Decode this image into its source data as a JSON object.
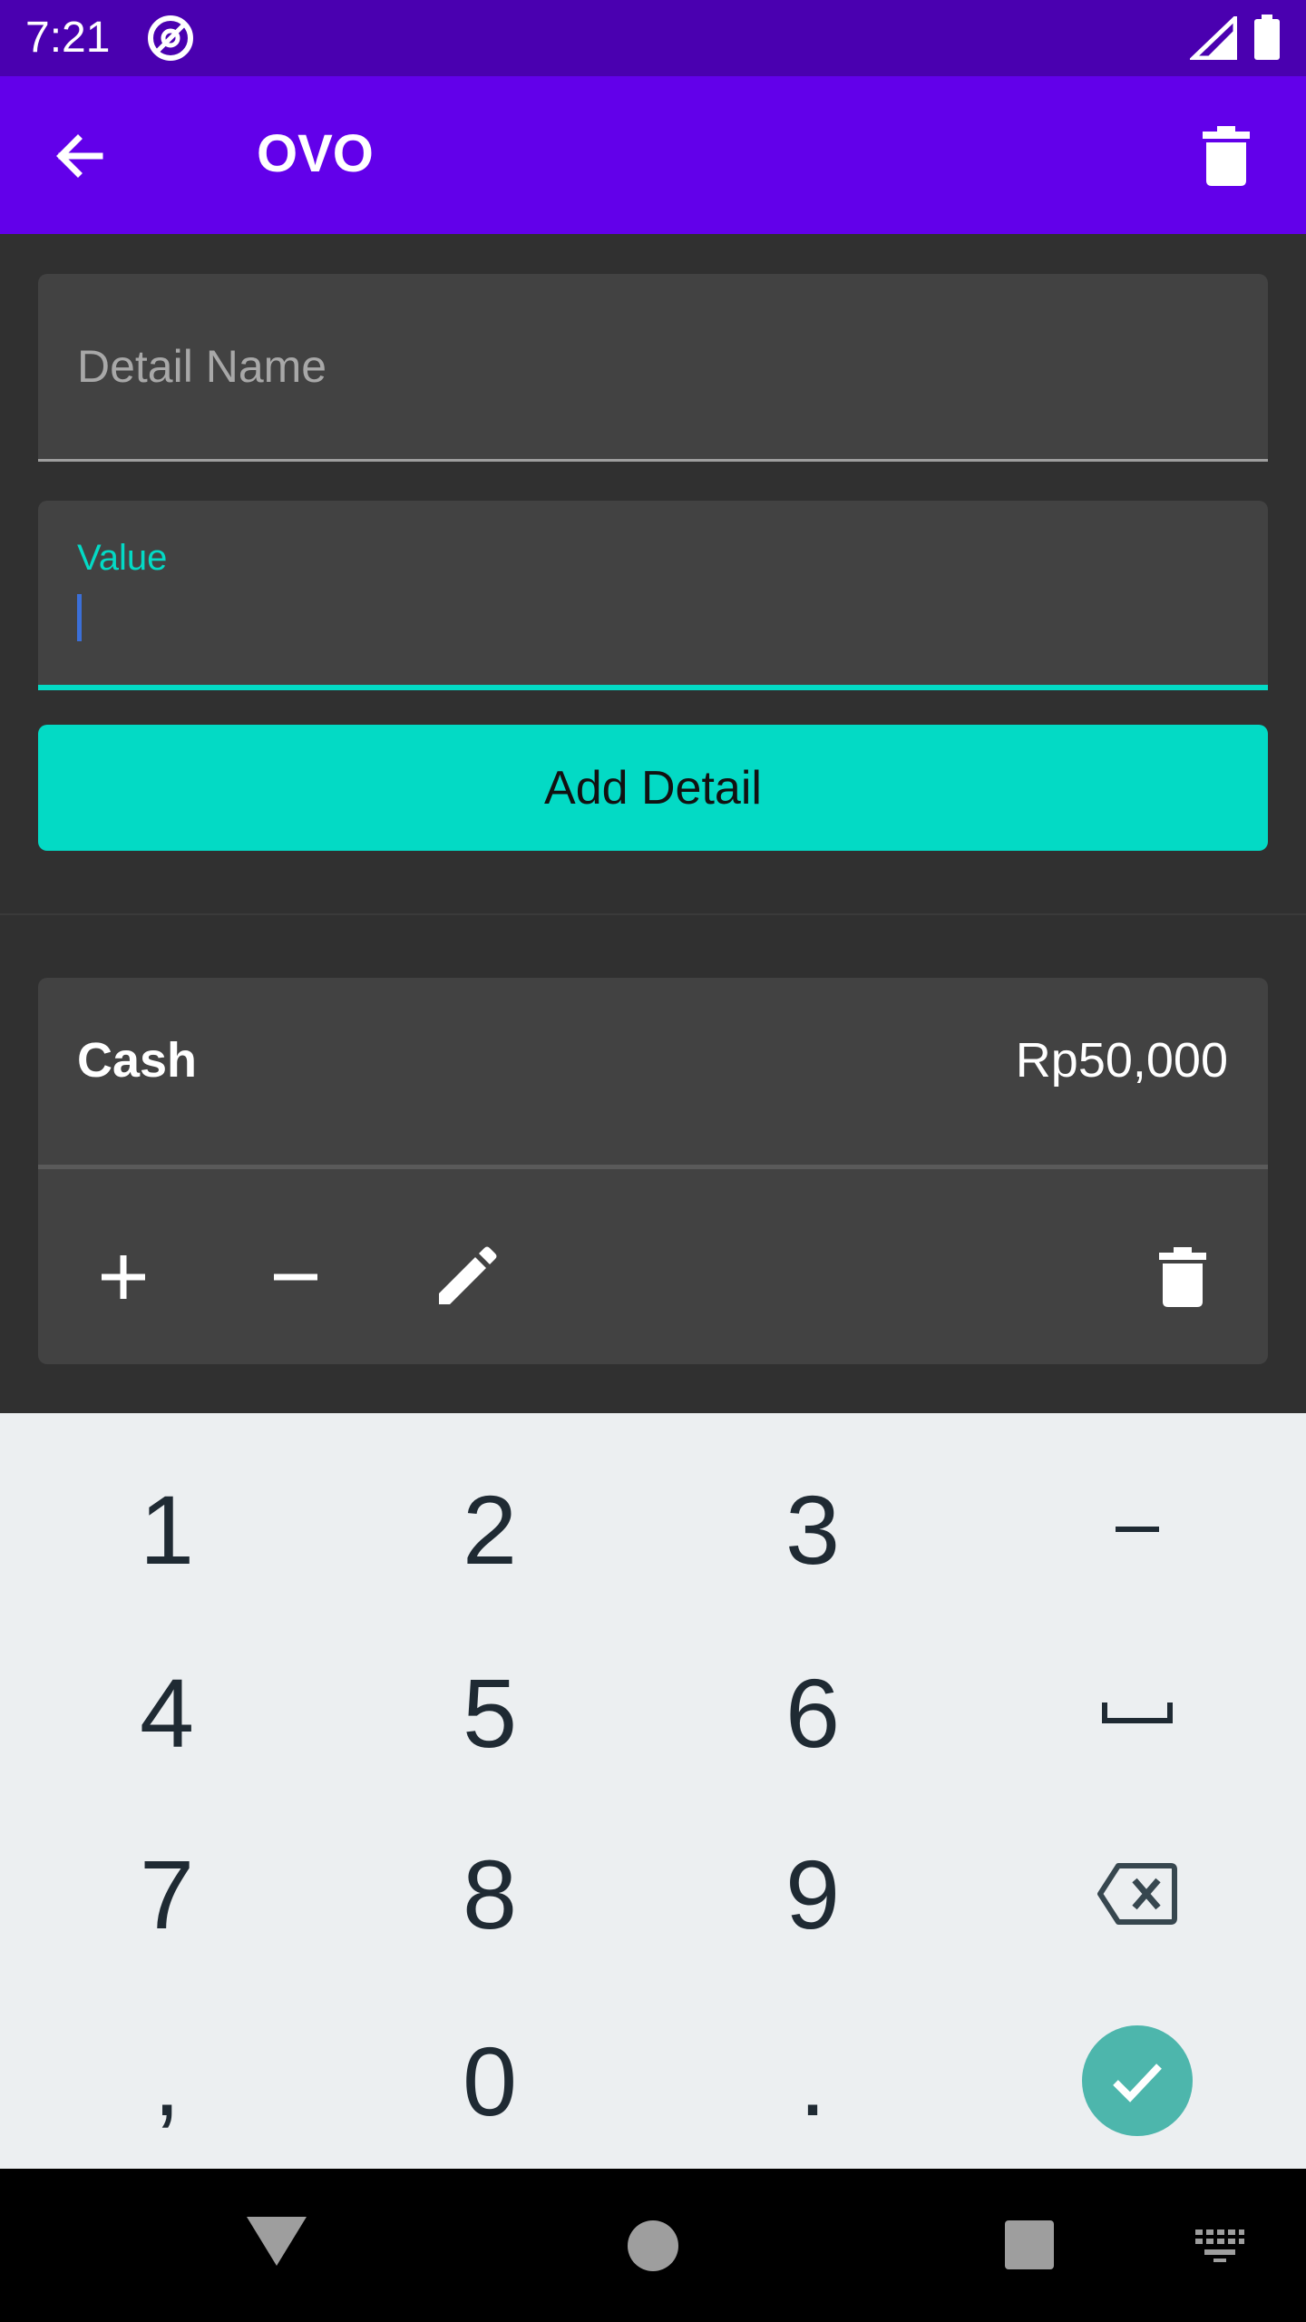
{
  "status_bar": {
    "time": "7:21",
    "app_icon": "at-sign-icon",
    "signal_icon": "signal-icon",
    "battery_icon": "battery-icon"
  },
  "app_bar": {
    "title": "OVO",
    "back_icon": "arrow-left-icon",
    "delete_icon": "trash-icon",
    "color": "#6200ea"
  },
  "form": {
    "detail_name": {
      "placeholder": "Detail Name",
      "value": ""
    },
    "value_field": {
      "label": "Value",
      "value": ""
    },
    "add_button_label": "Add Detail",
    "accent_color": "#03dac5"
  },
  "details": [
    {
      "name": "Cash",
      "value": "Rp50,000",
      "actions": [
        "plus-icon",
        "minus-icon",
        "pencil-icon",
        "trash-icon"
      ]
    }
  ],
  "keyboard": {
    "keys": [
      "1",
      "2",
      "3",
      "-",
      "4",
      "5",
      "6",
      "space",
      "7",
      "8",
      "9",
      "backspace",
      ",",
      "0",
      ".",
      "done"
    ],
    "row1": [
      "1",
      "2",
      "3",
      "–"
    ],
    "row2": [
      "4",
      "5",
      "6",
      "␣"
    ],
    "row3": [
      "7",
      "8",
      "9"
    ],
    "row4": [
      ",",
      "0",
      "."
    ]
  },
  "nav_bar": {
    "icons": [
      "nav-back-icon",
      "nav-home-icon",
      "nav-recents-icon",
      "keyboard-switch-icon"
    ]
  }
}
